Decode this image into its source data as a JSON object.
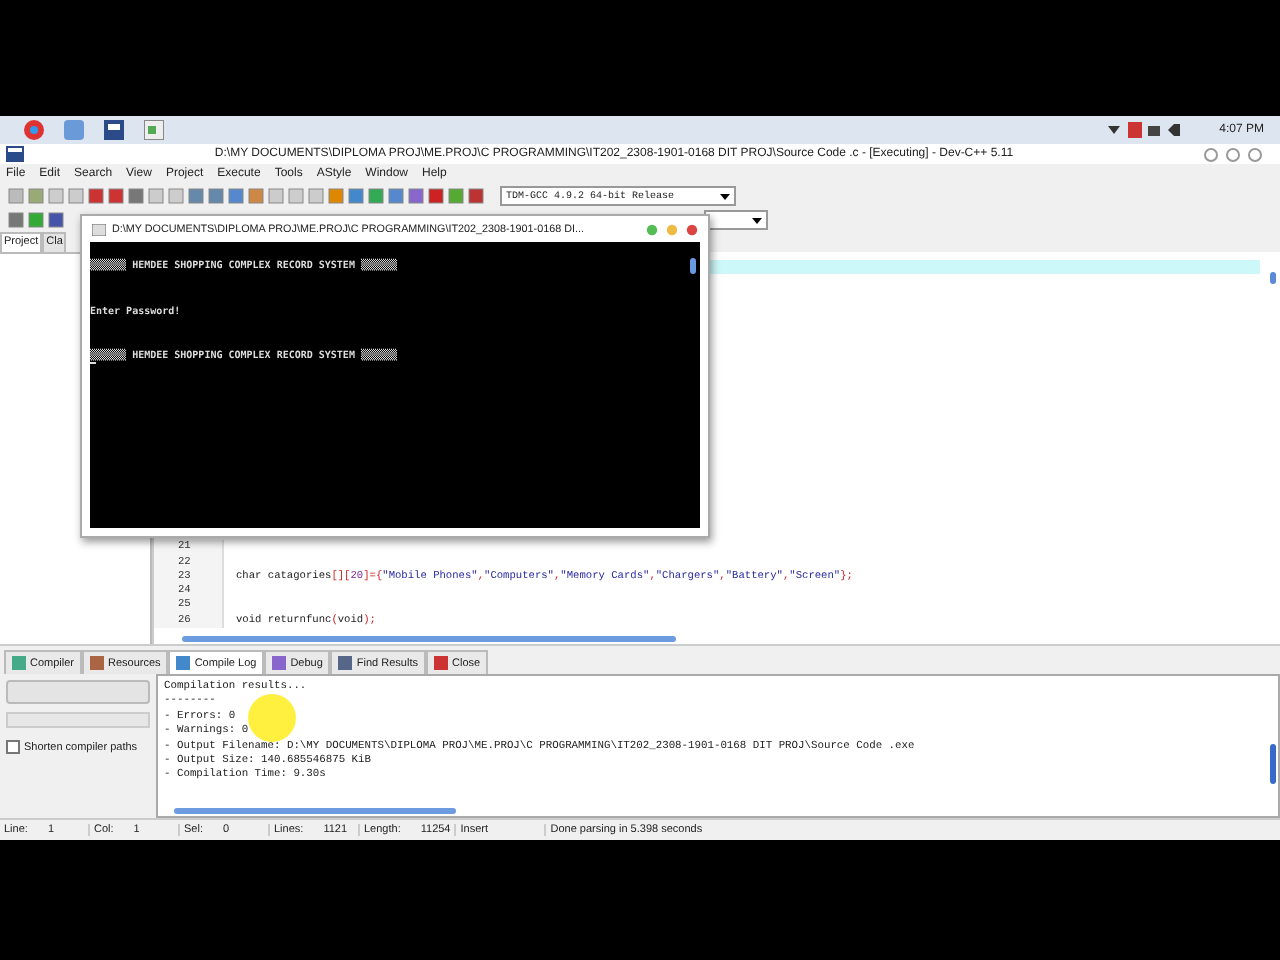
{
  "taskbar": {
    "clock": "4:07 PM"
  },
  "window": {
    "title": "D:\\MY DOCUMENTS\\DIPLOMA PROJ\\ME.PROJ\\C PROGRAMMING\\IT202_2308-1901-0168 DIT PROJ\\Source Code .c - [Executing] - Dev-C++ 5.11"
  },
  "menu": [
    "File",
    "Edit",
    "Search",
    "View",
    "Project",
    "Execute",
    "Tools",
    "AStyle",
    "Window",
    "Help"
  ],
  "toolbar": {
    "compiler": "TDM-GCC 4.9.2 64-bit Release"
  },
  "side_tabs": [
    {
      "label": "Project",
      "selected": true
    },
    {
      "label": "Cla",
      "selected": false
    }
  ],
  "editor": {
    "lines": [
      {
        "number": "21"
      },
      {
        "number": "22"
      },
      {
        "number": "23",
        "tokens": [
          {
            "text": "char catagories",
            "kind": "plain"
          },
          {
            "text": "[][",
            "kind": "punct"
          },
          {
            "text": "20",
            "kind": "number"
          },
          {
            "text": "]={",
            "kind": "punct"
          },
          {
            "text": "\"Mobile Phones\"",
            "kind": "string"
          },
          {
            "text": ",",
            "kind": "punct"
          },
          {
            "text": "\"Computers\"",
            "kind": "string"
          },
          {
            "text": ",",
            "kind": "punct"
          },
          {
            "text": "\"Memory Cards\"",
            "kind": "string"
          },
          {
            "text": ",",
            "kind": "punct"
          },
          {
            "text": "\"Chargers\"",
            "kind": "string"
          },
          {
            "text": ",",
            "kind": "punct"
          },
          {
            "text": "\"Battery\"",
            "kind": "string"
          },
          {
            "text": ",",
            "kind": "punct"
          },
          {
            "text": "\"Screen\"",
            "kind": "string"
          },
          {
            "text": "};",
            "kind": "punct"
          }
        ]
      },
      {
        "number": "24"
      },
      {
        "number": "25"
      },
      {
        "number": "26",
        "tokens": [
          {
            "text": "void returnfunc",
            "kind": "plain"
          },
          {
            "text": "(",
            "kind": "punct"
          },
          {
            "text": "void",
            "kind": "plain"
          },
          {
            "text": ");",
            "kind": "punct"
          }
        ]
      }
    ]
  },
  "console": {
    "title": "D:\\MY DOCUMENTS\\DIPLOMA PROJ\\ME.PROJ\\C PROGRAMMING\\IT202_2308-1901-0168 DI...",
    "lines": [
      {
        "kind": "blank"
      },
      {
        "kind": "text",
        "text": "▒▒▒▒▒▒ HEMDEE SHOPPING COMPLEX RECORD SYSTEM ▒▒▒▒▒▒"
      },
      {
        "kind": "blank"
      },
      {
        "kind": "blank"
      },
      {
        "kind": "text",
        "text": "Enter Password!"
      },
      {
        "kind": "blank"
      },
      {
        "kind": "blank"
      },
      {
        "kind": "text",
        "text": "▒▒▒▒▒▒ HEMDEE SHOPPING COMPLEX RECORD SYSTEM ▒▒▒▒▒▒"
      }
    ]
  },
  "bottom_tabs": [
    {
      "label": "Compiler",
      "selected": false
    },
    {
      "label": "Resources",
      "selected": false
    },
    {
      "label": "Compile Log",
      "selected": true
    },
    {
      "label": "Debug",
      "selected": false
    },
    {
      "label": "Find Results",
      "selected": false
    },
    {
      "label": "Close",
      "selected": false
    }
  ],
  "compile_panel": {
    "shorten_paths": {
      "label": "Shorten compiler paths",
      "checked": false
    }
  },
  "compile_log": [
    "Compilation results...",
    "--------",
    "- Errors: 0",
    "- Warnings: 0",
    "- Output Filename: D:\\MY DOCUMENTS\\DIPLOMA PROJ\\ME.PROJ\\C PROGRAMMING\\IT202_2308-1901-0168 DIT PROJ\\Source Code .exe",
    "- Output Size: 140.685546875 KiB",
    "- Compilation Time: 9.30s"
  ],
  "status_bar": [
    {
      "label": "Line:",
      "value": "1"
    },
    {
      "label": "Col:",
      "value": "1"
    },
    {
      "label": "Sel:",
      "value": "0"
    },
    {
      "label": "Lines:",
      "value": "1121"
    },
    {
      "label": "Length:",
      "value": "11254"
    },
    {
      "label": "Insert"
    },
    {
      "label": "Done parsing in 5.398 seconds"
    }
  ]
}
